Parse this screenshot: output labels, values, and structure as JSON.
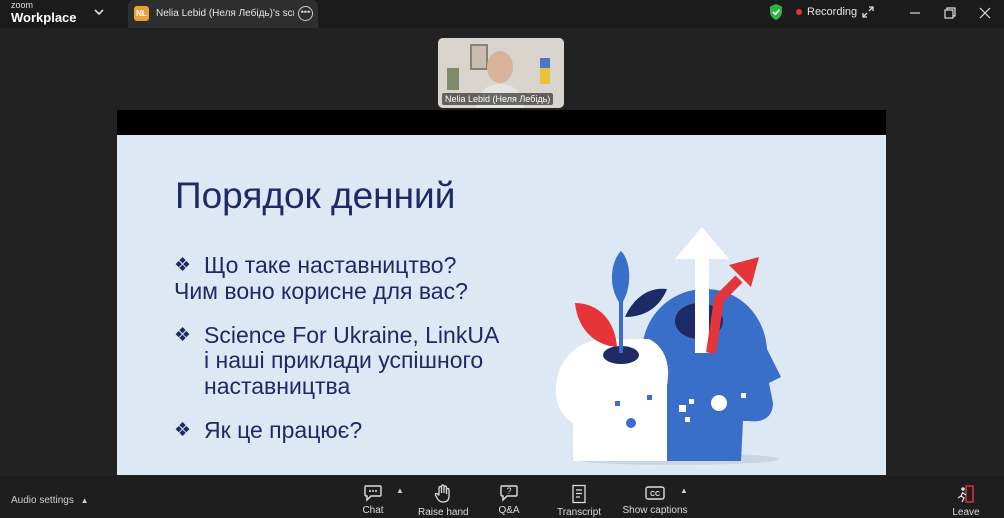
{
  "app": {
    "brand_top": "zoom",
    "brand_bottom": "Workplace"
  },
  "tab": {
    "badge": "NL",
    "title": "Nelia Lebid (Неля Лебідь)'s screer"
  },
  "status": {
    "recording": "Recording"
  },
  "participant": {
    "name": "Nelia Lebid (Неля Лебідь)"
  },
  "slide": {
    "title": "Порядок денний",
    "items": [
      {
        "bullet": "❖",
        "line1": "Що таке наставництво?",
        "line2": "Чим воно корисне для вас?"
      },
      {
        "bullet": "❖",
        "line1": "Science For Ukraine, LinkUA",
        "line2": "і наші приклади успішного",
        "line3": "наставництва"
      },
      {
        "bullet": "❖",
        "line1": "Як це працює?"
      }
    ]
  },
  "toolbar": {
    "audio_settings": "Audio settings",
    "chat": "Chat",
    "raise_hand": "Raise hand",
    "qa": "Q&A",
    "transcript": "Transcript",
    "show_captions": "Show captions",
    "leave": "Leave"
  },
  "colors": {
    "accent_red": "#e5343a",
    "slide_bg": "#dce8f3",
    "slide_text": "#1e2a66",
    "art_blue": "#3a6fc9"
  }
}
